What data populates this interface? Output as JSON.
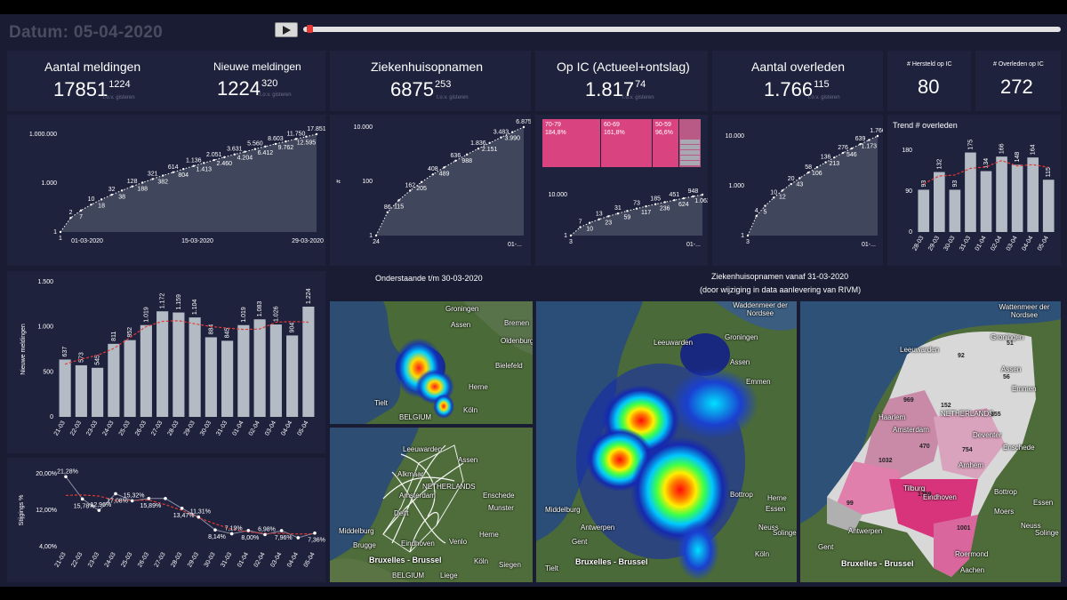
{
  "header": {
    "date_label": "Datum: 05-04-2020"
  },
  "playback": {
    "progress": 0.005
  },
  "kpis": {
    "meldingen": {
      "title": "Aantal meldingen",
      "value": "17851",
      "delta": "1224",
      "sub": "t.o.v. gisteren"
    },
    "nieuw": {
      "title": "Nieuwe meldingen",
      "value": "1224",
      "delta": "320",
      "sub": "t.o.v. gisteren"
    },
    "zkh": {
      "title": "Ziekenhuisopnamen",
      "value": "6875",
      "delta": "253",
      "sub": "t.o.v. gisteren"
    },
    "ic": {
      "title": "Op IC (Actueel+ontslag)",
      "value": "1.817",
      "delta": "74",
      "sub": "t.o.v. gisteren"
    },
    "overleden": {
      "title": "Aantal overleden",
      "value": "1.766",
      "delta": "115",
      "sub": "t.o.v. gisteren"
    },
    "hersteld": {
      "title": "# Hersteld op IC",
      "value": "80"
    },
    "overleden_ic": {
      "title": "# Overleden op IC",
      "value": "272"
    }
  },
  "trend_title": "Trend # overleden",
  "stijging_ylabel": "Stijgings %",
  "nieuw_ylabel": "Nieuwe meldingen",
  "zkh_ylabel": "#",
  "captions": {
    "left": "Onderstaande t/m 30-03-2020",
    "right_line1": "Ziekenhuisopnamen vanaf 31-03-2020",
    "right_line2": "(door wijziging in data aanlevering van RIVM)"
  },
  "treemap": [
    {
      "label": "70-79",
      "pct": "184,8%"
    },
    {
      "label": "60-69",
      "pct": "161,8%"
    },
    {
      "label": "50-59",
      "pct": "96,6%"
    }
  ],
  "maps": {
    "top_left": [
      "Groningen",
      "Assen",
      "Bremen",
      "Oldenburg",
      "Bielefeld",
      "Herne",
      "Tielt",
      "Köln",
      "BELGIUM"
    ],
    "bottom_left": [
      "Leeuwarden",
      "Alkmaar",
      "Assen",
      "Amsterdam",
      "NETHERLANDS",
      "Enschede",
      "Munster",
      "Delft",
      "Middelburg",
      "Brugge",
      "Eindhoven",
      "Venlo",
      "Herne",
      "Bruxelles - Brussel",
      "Köln",
      "Siegen",
      "Liege",
      "BELGIUM"
    ],
    "center": [
      "Waddenmeer der Nordsee",
      "Leeuwarden",
      "Groningen",
      "Assen",
      "Emmen",
      "Bottrop",
      "Herne",
      "Essen",
      "Neuss",
      "Solingen",
      "Köln",
      "Middelburg",
      "Antwerpen",
      "Gent",
      "Bruxelles - Brussel",
      "Tielt"
    ],
    "right": [
      "Wattenmeer der Nordsee",
      "Leeuwarden",
      "Groningen",
      "Assen",
      "Emmen",
      "Haarlem",
      "Amsterdam",
      "NETHERLANDS",
      "Deventer",
      "Enschede",
      "Arnhem",
      "Tilburg",
      "Eindhoven",
      "Bottrop",
      "Moers",
      "Essen",
      "Neuss",
      "Solinge",
      "Antwerpen",
      "Gent",
      "Bruxelles - Brussel",
      "Aachen",
      "Roermond"
    ],
    "right_counts": [
      "51",
      "92",
      "56",
      "969",
      "152",
      "355",
      "470",
      "754",
      "1032",
      "1759",
      "99",
      "1001"
    ]
  },
  "colors": {
    "bar": "#b3bcc5",
    "area": "#444a5e",
    "trend": "#e53935",
    "treemap": "#d9437f",
    "accent": "#ffffff"
  },
  "chart_data": [
    {
      "id": "meldingen",
      "type": "area",
      "y_scale": "log",
      "ylim": [
        1,
        100000
      ],
      "y_ticks": [
        "1",
        "1.000",
        "1.000.000"
      ],
      "x_ticks": [
        "01-03-2020",
        "15-03-2020",
        "29-03-2020"
      ],
      "point_labels": [
        "1",
        "2",
        "7",
        "10",
        "18",
        "32",
        "38",
        "128",
        "188",
        "321",
        "382",
        "614",
        "804",
        "1.136",
        "1.413",
        "2.051",
        "2.460",
        "3.631",
        "4.204",
        "5.560",
        "6.412",
        "8.603",
        "9.762",
        "11.750",
        "12.595",
        "17.851"
      ]
    },
    {
      "id": "ziekenhuis",
      "type": "area",
      "y_scale": "log",
      "ylabel": "#",
      "y_ticks": [
        "1",
        "100",
        "10.000"
      ],
      "x_ticks": [
        "01-..."
      ],
      "point_labels": [
        "24",
        "86",
        "115",
        "162",
        "205",
        "408",
        "489",
        "636",
        "988",
        "1.836",
        "2.151",
        "3.483",
        "3.990",
        "6.875"
      ]
    },
    {
      "id": "ic",
      "type": "area",
      "y_scale": "log",
      "y_ticks": [
        "1",
        "10.000"
      ],
      "x_ticks": [
        "01-..."
      ],
      "point_labels": [
        "3",
        "7",
        "10",
        "13",
        "23",
        "31",
        "59",
        "73",
        "117",
        "185",
        "236",
        "451",
        "624",
        "948",
        "1.063"
      ]
    },
    {
      "id": "overleden",
      "type": "area",
      "y_scale": "log",
      "y_ticks": [
        "1",
        "1.000",
        "10.000"
      ],
      "x_ticks": [
        "01-..."
      ],
      "point_labels": [
        "3",
        "4",
        "5",
        "10",
        "12",
        "20",
        "43",
        "58",
        "106",
        "136",
        "213",
        "276",
        "546",
        "639",
        "1.173",
        "1.766"
      ]
    },
    {
      "id": "trend_overleden",
      "type": "bar",
      "title": "Trend # overleden",
      "categories": [
        "28-03",
        "29-03",
        "30-03",
        "31-03",
        "01-04",
        "02-04",
        "03-04",
        "04-04",
        "05-04"
      ],
      "values": [
        93,
        132,
        93,
        175,
        134,
        166,
        148,
        164,
        115
      ],
      "value_labels": [
        "93",
        "132",
        "93",
        "175",
        "134",
        "166",
        "148",
        "164",
        "115"
      ],
      "ylim": [
        0,
        180
      ],
      "y_ticks": [
        "0",
        "90",
        "180"
      ]
    },
    {
      "id": "nieuwe_meldingen",
      "type": "bar",
      "ylabel": "Nieuwe meldingen",
      "categories": [
        "21-03",
        "22-03",
        "23-03",
        "24-03",
        "25-03",
        "26-03",
        "27-03",
        "28-03",
        "29-03",
        "30-03",
        "31-03",
        "01-04",
        "02-04",
        "03-04",
        "04-04",
        "05-04"
      ],
      "values": [
        637,
        573,
        545,
        811,
        852,
        1019,
        1172,
        1159,
        1104,
        884,
        845,
        1019,
        1083,
        1026,
        904,
        1224
      ],
      "value_labels": [
        "637",
        "573",
        "545",
        "811",
        "852",
        "1.019",
        "1.172",
        "1.159",
        "1.104",
        "884",
        "845",
        "1.019",
        "1.083",
        "1.026",
        "904",
        "1.224"
      ],
      "ylim": [
        0,
        1500
      ],
      "y_ticks": [
        "0",
        "500",
        "1.000",
        "1.500"
      ]
    },
    {
      "id": "stijging",
      "type": "line",
      "ylabel": "Stijgings %",
      "categories": [
        "21-03",
        "22-03",
        "23-03",
        "24-03",
        "25-03",
        "26-03",
        "27-03",
        "28-03",
        "29-03",
        "30-03",
        "31-03",
        "01-04",
        "02-04",
        "03-04",
        "04-04",
        "05-04"
      ],
      "values": [
        21.28,
        15.78,
        12.96,
        17.08,
        15.32,
        15.89,
        15.89,
        13.47,
        11.31,
        8.14,
        7.19,
        8.0,
        6.98,
        7.96,
        6.2,
        7.36
      ],
      "value_labels": [
        "21,28%",
        "15,78%",
        "12,96%",
        "17,08%",
        "15,32%",
        "15,89%",
        "",
        "13,47%",
        "11,31%",
        "8,14%",
        "7,19%",
        "8,00%",
        "6,98%",
        "7,96%",
        "",
        "7,36%"
      ],
      "ylim": [
        4,
        22
      ],
      "y_ticks": [
        "4,00%",
        "12,00%",
        "20,00%"
      ]
    }
  ]
}
